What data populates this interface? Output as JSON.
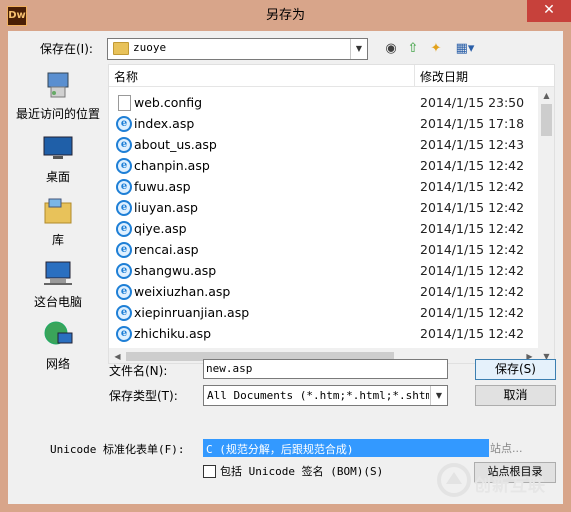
{
  "window": {
    "title": "另存为",
    "app_icon_text": "Dw",
    "close_glyph": "✕"
  },
  "save_in": {
    "label": "保存在(I):",
    "folder": "zuoye"
  },
  "places": [
    {
      "label": "最近访问的位置",
      "icon": "recent-places-icon"
    },
    {
      "label": "桌面",
      "icon": "desktop-icon"
    },
    {
      "label": "库",
      "icon": "library-icon"
    },
    {
      "label": "这台电脑",
      "icon": "this-pc-icon"
    },
    {
      "label": "网络",
      "icon": "network-icon"
    }
  ],
  "file_list": {
    "col_name": "名称",
    "col_date": "修改日期",
    "files": [
      {
        "name": "web.config",
        "date": "2014/1/15 23:50",
        "type": "doc"
      },
      {
        "name": "index.asp",
        "date": "2014/1/15 17:18",
        "type": "ie"
      },
      {
        "name": "about_us.asp",
        "date": "2014/1/15 12:43",
        "type": "ie"
      },
      {
        "name": "chanpin.asp",
        "date": "2014/1/15 12:42",
        "type": "ie"
      },
      {
        "name": "fuwu.asp",
        "date": "2014/1/15 12:42",
        "type": "ie"
      },
      {
        "name": "liuyan.asp",
        "date": "2014/1/15 12:42",
        "type": "ie"
      },
      {
        "name": "qiye.asp",
        "date": "2014/1/15 12:42",
        "type": "ie"
      },
      {
        "name": "rencai.asp",
        "date": "2014/1/15 12:42",
        "type": "ie"
      },
      {
        "name": "shangwu.asp",
        "date": "2014/1/15 12:42",
        "type": "ie"
      },
      {
        "name": "weixiuzhan.asp",
        "date": "2014/1/15 12:42",
        "type": "ie"
      },
      {
        "name": "xiepinruanjian.asp",
        "date": "2014/1/15 12:42",
        "type": "ie"
      },
      {
        "name": "zhichiku.asp",
        "date": "2014/1/15 12:42",
        "type": "ie"
      }
    ]
  },
  "filename": {
    "label": "文件名(N):",
    "value": "new.asp"
  },
  "filetype": {
    "label": "保存类型(T):",
    "value": "All Documents (*.htm;*.html;*.shtm;*."
  },
  "buttons": {
    "save": "保存(S)",
    "cancel": "取消",
    "site_root": "站点...",
    "site_root_btn": "站点根目录"
  },
  "unicode": {
    "label": "Unicode 标准化表单(F):",
    "value": "C (规范分解，后跟规范合成)"
  },
  "bom": {
    "label": "包括 Unicode 签名 (BOM)(S)"
  },
  "watermark": {
    "text": "创新互联"
  },
  "colors": {
    "titlebar": "#d8a58a",
    "close": "#c7413b",
    "selection": "#3399ff"
  }
}
